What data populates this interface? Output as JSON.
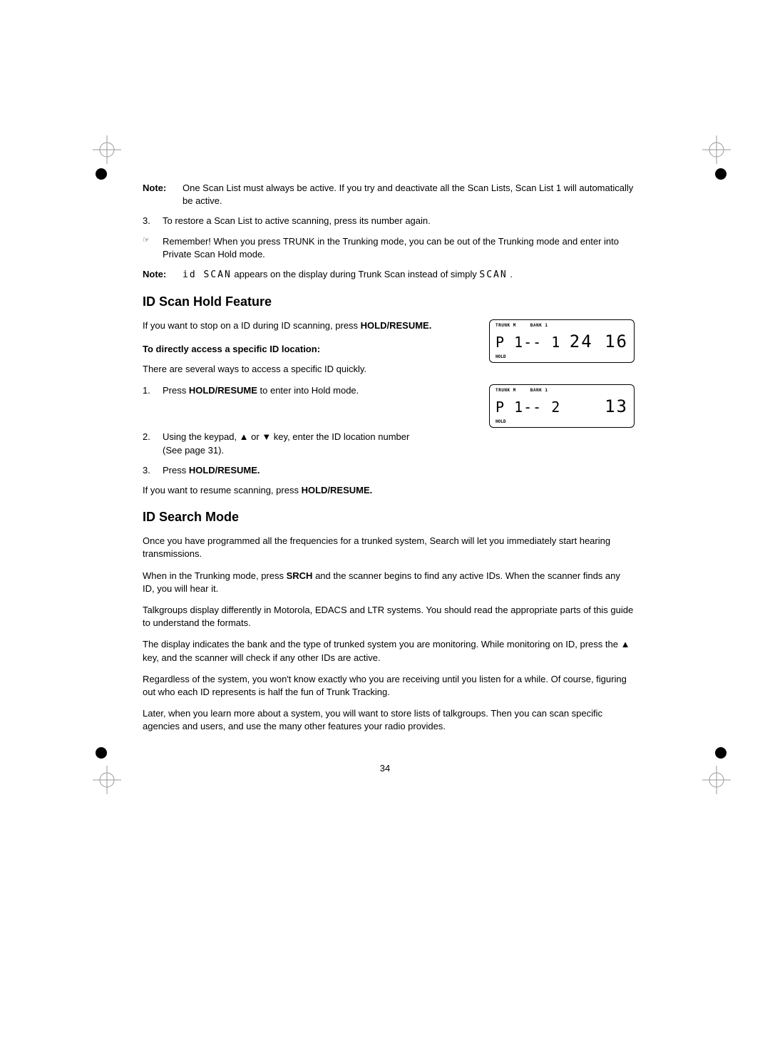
{
  "note1": {
    "label": "Note:",
    "text": "One Scan List must always be active. If you try and deactivate all the Scan Lists, Scan List 1 will automatically be active."
  },
  "item3": {
    "num": "3.",
    "text": "To restore a Scan List to active scanning, press its number again."
  },
  "remember": {
    "icon": "☞",
    "text": "Remember! When you press TRUNK in the Trunking mode, you can be out of the Trunking mode and enter into Private Scan Hold mode."
  },
  "note2": {
    "label": "Note:",
    "seg1": "id SCAN",
    "mid": " appears on the display during Trunk Scan instead of simply ",
    "seg2": "SCAN",
    "end": " ."
  },
  "heading1": "ID Scan Hold Feature",
  "para1a": "If you want to stop on a ID during ID scanning, press ",
  "para1b": "HOLD/RESUME.",
  "subheading1": "To directly access a specific ID location:",
  "para2": "There are several ways to access a specific ID quickly.",
  "step1": {
    "num": "1.",
    "prefix": "Press ",
    "bold": "HOLD/RESUME",
    "suffix": " to enter into Hold mode."
  },
  "step2": {
    "num": "2.",
    "text": "Using the keypad, ▲ or ▼ key, enter the ID location number (See page 31)."
  },
  "step3": {
    "num": "3.",
    "prefix": "Press ",
    "bold": "HOLD/RESUME."
  },
  "para3a": "If you want to resume scanning, press ",
  "para3b": "HOLD/RESUME.",
  "heading2": "ID Search Mode",
  "para4": "Once you have programmed all the frequencies for a trunked system, Search will let you immediately start hearing transmissions.",
  "para5a": "When in the Trunking mode, press ",
  "para5b": "SRCH",
  "para5c": " and the scanner begins to find any active IDs. When the scanner finds any ID, you will hear it.",
  "para6": "Talkgroups display differently in Motorola, EDACS and LTR systems. You should read the appropriate parts of this guide to understand the formats.",
  "para7": "The display indicates the bank and the type of trunked system you are monitoring. While monitoring on ID, press the ▲ key, and the scanner will check if any other IDs are active.",
  "para8": "Regardless of the system, you won't know exactly who you are receiving until you listen for a while. Of course, figuring out who each ID represents is half the fun of Trunk Tracking.",
  "para9": "Later, when you learn more about a system, you will want to store lists of talkgroups. Then you can scan specific agencies and users, and use the many other features your radio provides.",
  "display1": {
    "top1": "TRUNK M",
    "top2": "BANK 1",
    "left": "P 1-- 1",
    "right": "24 16",
    "bottom": "HOLD"
  },
  "display2": {
    "top1": "TRUNK M",
    "top2": "BANK 1",
    "left": "P 1-- 2",
    "right": "13",
    "bottom": "HOLD"
  },
  "pageNum": "34"
}
